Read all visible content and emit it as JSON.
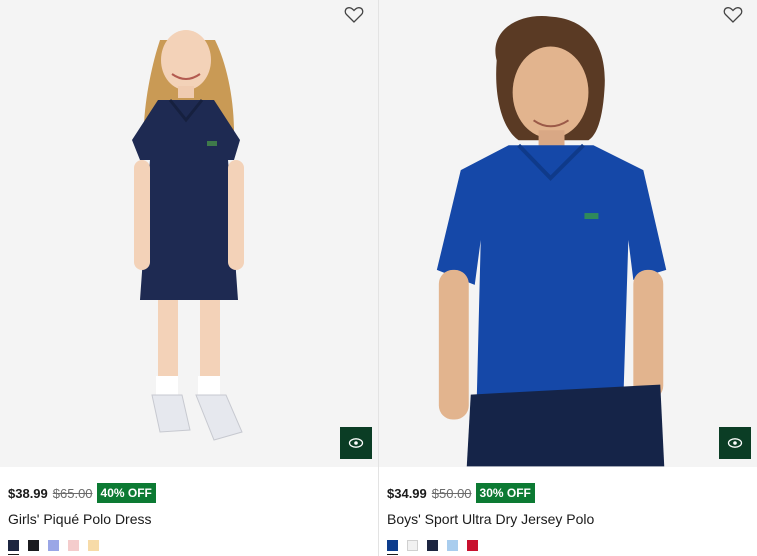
{
  "products": [
    {
      "price": "$38.99",
      "original_price": "$65.00",
      "discount": "40% OFF",
      "name": "Girls' Piqué Polo Dress",
      "swatches": [
        "#1c2540",
        "#1b1b1f",
        "#9aa6e6",
        "#f4cccc",
        "#f7dba8"
      ]
    },
    {
      "price": "$34.99",
      "original_price": "$50.00",
      "discount": "30% OFF",
      "name": "Boys' Sport Ultra Dry Jersey Polo",
      "swatches": [
        "#0c3c8c",
        "#f1f1f1",
        "#1c2540",
        "#a9cdee",
        "#c8102e"
      ]
    }
  ],
  "colors": {
    "badge": "#0c7a33",
    "quick_view": "#0b3d25",
    "image_bg": "#f4f4f4"
  },
  "icons": {
    "wishlist": "heart-outline-icon",
    "quick_view": "eye-icon"
  }
}
